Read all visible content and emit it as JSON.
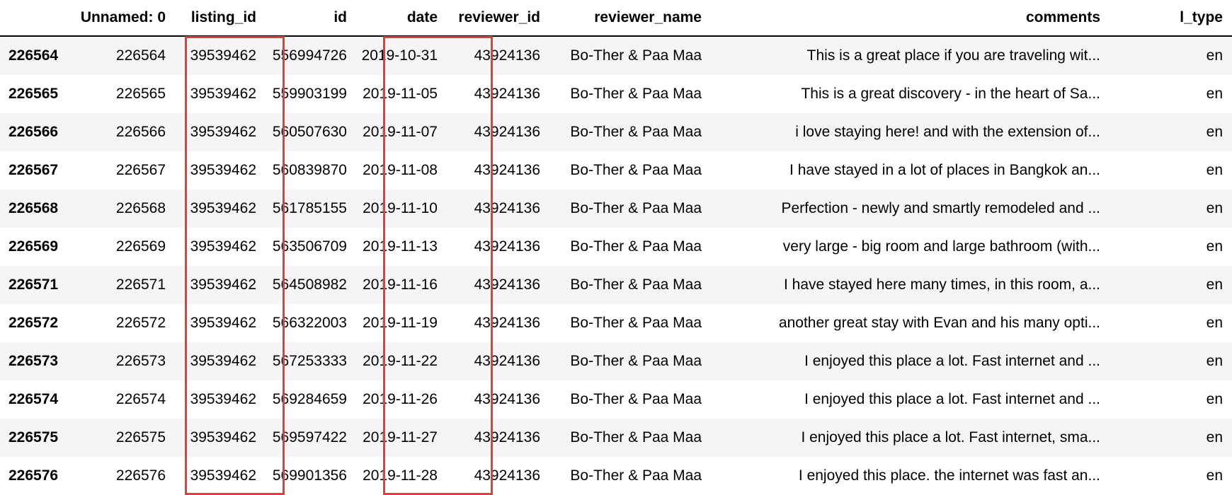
{
  "columns": [
    "",
    "Unnamed: 0",
    "listing_id",
    "id",
    "date",
    "reviewer_id",
    "reviewer_name",
    "comments",
    "l_type"
  ],
  "rows": [
    [
      "226564",
      "226564",
      "39539462",
      "556994726",
      "2019-10-31",
      "43924136",
      "Bo-Ther & Paa Maa",
      "This is a great place if you are traveling wit...",
      "en"
    ],
    [
      "226565",
      "226565",
      "39539462",
      "559903199",
      "2019-11-05",
      "43924136",
      "Bo-Ther & Paa Maa",
      "This is a great discovery - in the heart of Sa...",
      "en"
    ],
    [
      "226566",
      "226566",
      "39539462",
      "560507630",
      "2019-11-07",
      "43924136",
      "Bo-Ther & Paa Maa",
      "i love staying here! and with the extension of...",
      "en"
    ],
    [
      "226567",
      "226567",
      "39539462",
      "560839870",
      "2019-11-08",
      "43924136",
      "Bo-Ther & Paa Maa",
      "I have stayed in a lot of places in Bangkok an...",
      "en"
    ],
    [
      "226568",
      "226568",
      "39539462",
      "561785155",
      "2019-11-10",
      "43924136",
      "Bo-Ther & Paa Maa",
      "Perfection - newly and smartly remodeled and ...",
      "en"
    ],
    [
      "226569",
      "226569",
      "39539462",
      "563506709",
      "2019-11-13",
      "43924136",
      "Bo-Ther & Paa Maa",
      "very large - big room and large bathroom (with...",
      "en"
    ],
    [
      "226571",
      "226571",
      "39539462",
      "564508982",
      "2019-11-16",
      "43924136",
      "Bo-Ther & Paa Maa",
      "I have stayed here many times, in this room, a...",
      "en"
    ],
    [
      "226572",
      "226572",
      "39539462",
      "566322003",
      "2019-11-19",
      "43924136",
      "Bo-Ther & Paa Maa",
      "another great stay with Evan and his many opti...",
      "en"
    ],
    [
      "226573",
      "226573",
      "39539462",
      "567253333",
      "2019-11-22",
      "43924136",
      "Bo-Ther & Paa Maa",
      "I enjoyed this place a lot. Fast internet and ...",
      "en"
    ],
    [
      "226574",
      "226574",
      "39539462",
      "569284659",
      "2019-11-26",
      "43924136",
      "Bo-Ther & Paa Maa",
      "I enjoyed this place a lot. Fast internet and ...",
      "en"
    ],
    [
      "226575",
      "226575",
      "39539462",
      "569597422",
      "2019-11-27",
      "43924136",
      "Bo-Ther & Paa Maa",
      "I enjoyed this place a lot. Fast internet, sma...",
      "en"
    ],
    [
      "226576",
      "226576",
      "39539462",
      "569901356",
      "2019-11-28",
      "43924136",
      "Bo-Ther & Paa Maa",
      "I enjoyed this place. the internet was fast an...",
      "en"
    ]
  ],
  "highlight_color": "#e5402f",
  "highlighted_columns": [
    "listing_id",
    "date"
  ]
}
